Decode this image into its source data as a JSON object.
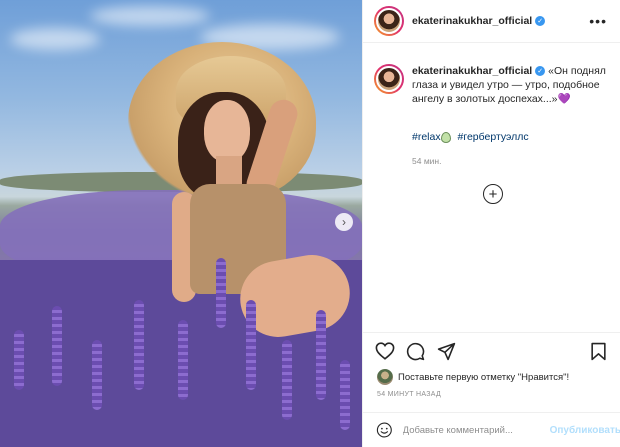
{
  "post": {
    "username": "ekaterinakukhar_official",
    "verified_icon": "verified-badge-icon",
    "more_icon": "more-options-icon",
    "caption_text": "«Он поднял глаза и увидел утро — утро, подобное ангелу в золотых доспехах...»",
    "caption_emoji": "💜",
    "hashtags": [
      "#relax",
      "#гербертуэллс"
    ],
    "tag_emoji_icon": "droplet-face-emoji-icon",
    "caption_time": "54 мин.",
    "load_more_icon": "plus-circle-icon",
    "accent_color": "#3897f0"
  },
  "actions": {
    "like_icon": "heart-icon",
    "comment_icon": "comment-icon",
    "share_icon": "paper-plane-icon",
    "save_icon": "bookmark-icon"
  },
  "likes": {
    "text": "Поставьте первую отметку \"Нравится\"!"
  },
  "timestamp": "54 МИНУТ НАЗАД",
  "comment": {
    "emoji_icon": "smile-icon",
    "placeholder": "Добавьте комментарий...",
    "value": "",
    "publish_label": "Опубликовать"
  },
  "photo": {
    "next_icon": "chevron-right-icon",
    "next_label": "›"
  }
}
